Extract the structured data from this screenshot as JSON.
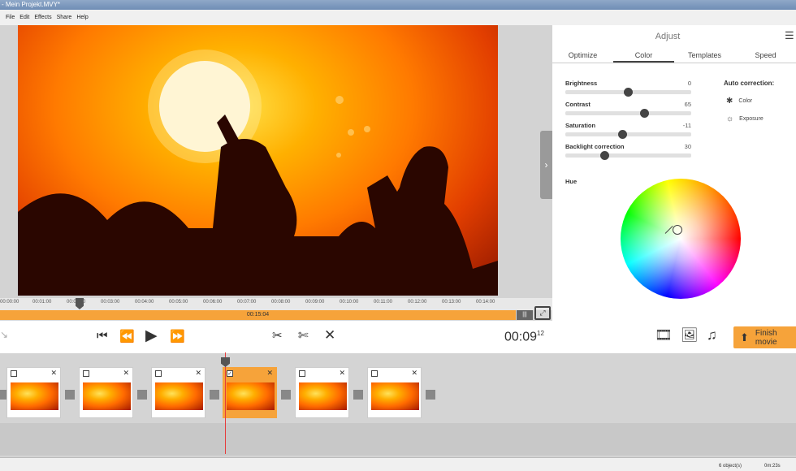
{
  "window": {
    "title": "- Mein Projekt.MVY*"
  },
  "menu": [
    "File",
    "Edit",
    "Effects",
    "Share",
    "Help"
  ],
  "ruler": [
    "00:00:00",
    "00:01:00",
    "00:02:00",
    "00:03:00",
    "00:04:00",
    "00:05:00",
    "00:06:00",
    "00:07:00",
    "00:08:00",
    "00:09:00",
    "00:10:00",
    "00:11:00",
    "00:12:00",
    "00:13:00",
    "00:14:00"
  ],
  "progress": {
    "label": "00:15:04"
  },
  "panel": {
    "title": "Adjust",
    "tabs": [
      "Optimize",
      "Color",
      "Templates",
      "Speed"
    ],
    "active_tab": "Color",
    "sliders": [
      {
        "label": "Brightness",
        "value": "0",
        "level": 0.5
      },
      {
        "label": "Contrast",
        "value": "65",
        "level": 0.64
      },
      {
        "label": "Saturation",
        "value": "-11",
        "level": 0.45
      },
      {
        "label": "Backlight correction",
        "value": "30",
        "level": 0.3
      }
    ],
    "auto_title": "Auto correction:",
    "auto_items": [
      {
        "label": "Color",
        "icon": "color-wand-icon"
      },
      {
        "label": "Exposure",
        "icon": "exposure-sun-icon"
      }
    ],
    "hue_label": "Hue"
  },
  "controls": {
    "timecode": "00:09",
    "timecode_frames": "12",
    "finish_label": "Finish movie"
  },
  "clips": [
    {
      "checked": false
    },
    {
      "checked": false
    },
    {
      "checked": false
    },
    {
      "checked": true,
      "selected": true
    },
    {
      "checked": false
    },
    {
      "checked": false
    }
  ],
  "status": {
    "objects": "6 object(s)",
    "duration": "0m:23s"
  },
  "colors": {
    "accent": "#f6a33a",
    "playhead": "#e53b3b"
  }
}
